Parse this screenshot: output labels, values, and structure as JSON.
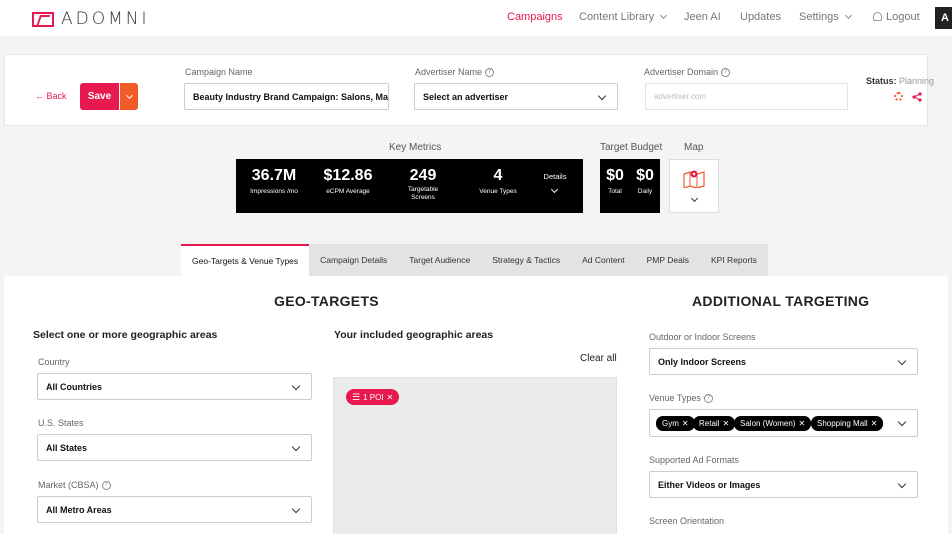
{
  "nav": {
    "logo_text": "ADOMNI",
    "items": [
      "Campaigns",
      "Content Library",
      "Jeen AI",
      "Updates",
      "Settings",
      "Logout"
    ],
    "avatar_letter": "A"
  },
  "header": {
    "back_label": "Back",
    "save_label": "Save",
    "campaign_name_label": "Campaign Name",
    "campaign_name_value": "Beauty Industry Brand Campaign:  Salons, Malls,",
    "advertiser_name_label": "Advertiser Name",
    "advertiser_name_value": "Select an advertiser",
    "advertiser_domain_label": "Advertiser Domain",
    "advertiser_domain_placeholder": "advertiser.com",
    "status_label": "Status:",
    "status_value": "Planning"
  },
  "metrics": {
    "title": "Key Metrics",
    "impressions_value": "36.7M",
    "impressions_label": "Impressions /mo",
    "ecpm_value": "$12.86",
    "ecpm_label": "eCPM Average",
    "screens_value": "249",
    "screens_label_1": "Targetable",
    "screens_label_2": "Screens",
    "venues_value": "4",
    "venues_label": "Venue Types",
    "details_label": "Details"
  },
  "budget": {
    "title": "Target Budget",
    "total_value": "$0",
    "total_label": "Total",
    "daily_value": "$0",
    "daily_label": "Daily"
  },
  "map": {
    "title": "Map"
  },
  "tabs": [
    "Geo-Targets & Venue Types",
    "Campaign Details",
    "Target Audience",
    "Strategy & Tactics",
    "Ad Content",
    "PMP Deals",
    "KPI Reports"
  ],
  "geo": {
    "title": "GEO-TARGETS",
    "select_heading": "Select one or more geographic areas",
    "country_label": "Country",
    "country_value": "All Countries",
    "states_label": "U.S. States",
    "states_value": "All States",
    "market_label": "Market (CBSA)",
    "market_value": "All Metro Areas",
    "included_heading": "Your included geographic areas",
    "clear_all": "Clear all",
    "poi_chip": "1 POI"
  },
  "additional": {
    "title": "ADDITIONAL TARGETING",
    "screens_label": "Outdoor or Indoor Screens",
    "screens_value": "Only Indoor Screens",
    "venue_types_label": "Venue Types",
    "venue_tags": [
      "Gym",
      "Retail",
      "Salon (Women)",
      "Shopping Mall"
    ],
    "formats_label": "Supported Ad Formats",
    "formats_value": "Either Videos or Images",
    "orientation_label": "Screen Orientation"
  },
  "colors": {
    "accent": "#e8194f",
    "accent2": "#f25a28"
  }
}
